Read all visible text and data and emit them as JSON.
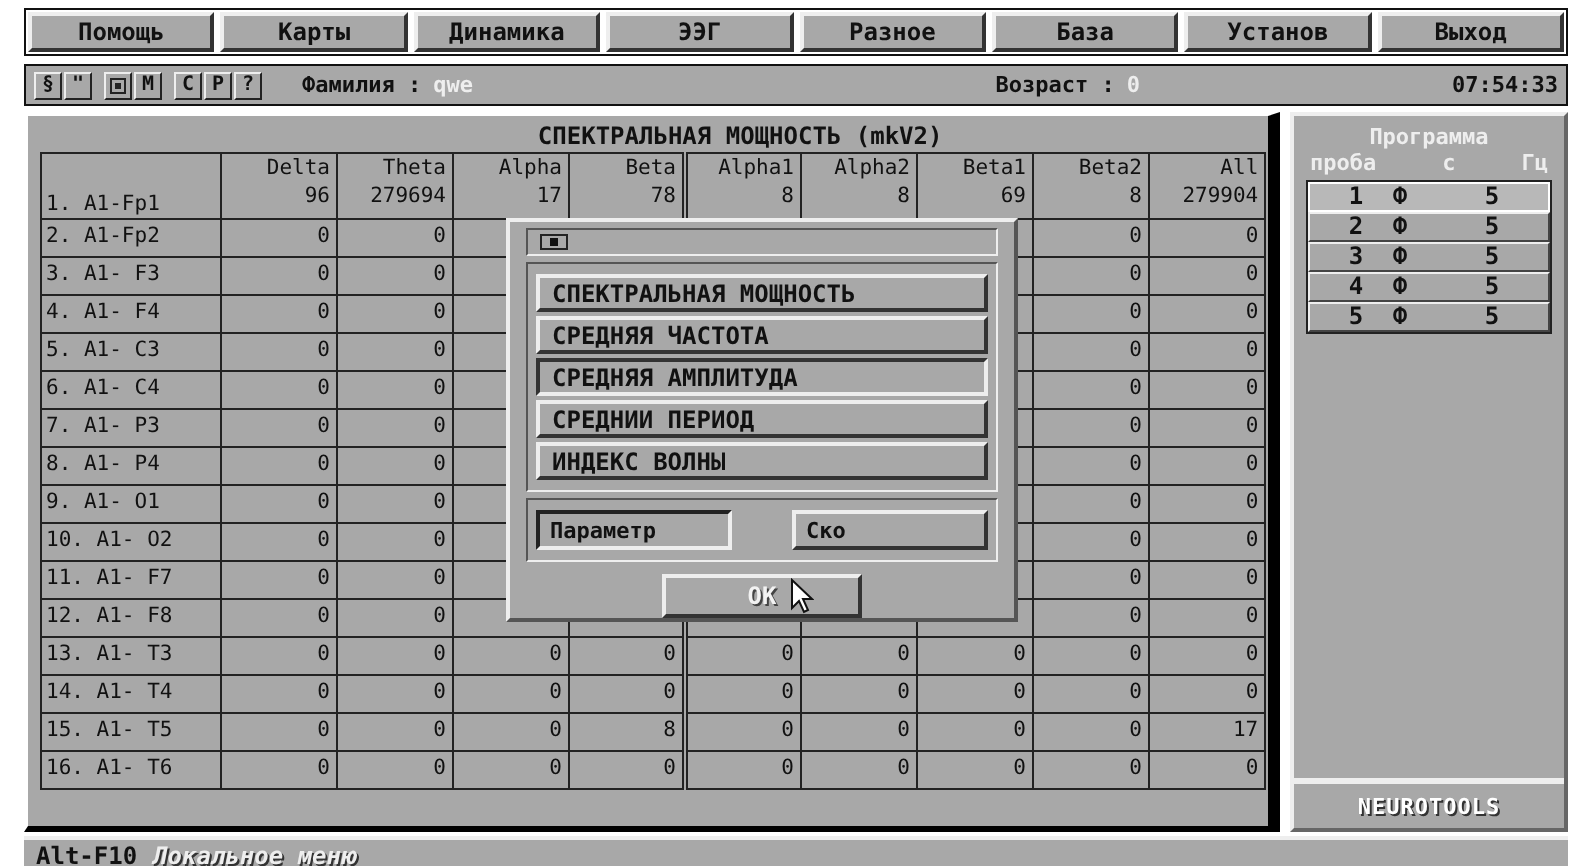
{
  "menu": [
    "Помощь",
    "Карты",
    "Динамика",
    "ЭЭГ",
    "Разное",
    "База",
    "Установ",
    "Выход"
  ],
  "toolbar": [
    {
      "kind": "text",
      "label": "§"
    },
    {
      "kind": "text",
      "label": "\""
    },
    {
      "kind": "icon"
    },
    {
      "kind": "text",
      "label": "M"
    },
    {
      "kind": "text",
      "label": "C"
    },
    {
      "kind": "text",
      "label": "P"
    },
    {
      "kind": "text",
      "label": "?"
    }
  ],
  "surname": {
    "label": "Фамилия :",
    "value": "qwe"
  },
  "age": {
    "label": "Возраст :",
    "value": "0"
  },
  "clock": "07:54:33",
  "table": {
    "title": "СПЕКТРАЛЬНАЯ МОЩНОСТЬ (mkV2)",
    "first_label": "1. A1-Fp1",
    "columns": [
      {
        "name": "Delta",
        "total": "96"
      },
      {
        "name": "Theta",
        "total": "279694"
      },
      {
        "name": "Alpha",
        "total": "17"
      },
      {
        "name": "Beta",
        "total": "78"
      },
      {
        "name": "Alpha1",
        "total": "8"
      },
      {
        "name": "Alpha2",
        "total": "8"
      },
      {
        "name": "Beta1",
        "total": "69"
      },
      {
        "name": "Beta2",
        "total": "8"
      },
      {
        "name": "All",
        "total": "279904"
      }
    ],
    "rows": [
      {
        "label": "2. A1-Fp2",
        "cells": [
          "0",
          "0",
          null,
          null,
          null,
          null,
          null,
          "0",
          "0"
        ]
      },
      {
        "label": "3. A1- F3",
        "cells": [
          "0",
          "0",
          null,
          null,
          null,
          null,
          null,
          "0",
          "0"
        ]
      },
      {
        "label": "4. A1- F4",
        "cells": [
          "0",
          "0",
          null,
          null,
          null,
          null,
          null,
          "0",
          "0"
        ]
      },
      {
        "label": "5. A1- C3",
        "cells": [
          "0",
          "0",
          null,
          null,
          null,
          null,
          null,
          "0",
          "0"
        ]
      },
      {
        "label": "6. A1- C4",
        "cells": [
          "0",
          "0",
          null,
          null,
          null,
          null,
          null,
          "0",
          "0"
        ]
      },
      {
        "label": "7. A1- P3",
        "cells": [
          "0",
          "0",
          null,
          null,
          null,
          null,
          null,
          "0",
          "0"
        ]
      },
      {
        "label": "8. A1- P4",
        "cells": [
          "0",
          "0",
          null,
          null,
          null,
          null,
          null,
          "0",
          "0"
        ]
      },
      {
        "label": "9. A1- O1",
        "cells": [
          "0",
          "0",
          null,
          null,
          null,
          null,
          null,
          "0",
          "0"
        ]
      },
      {
        "label": "10. A1- O2",
        "cells": [
          "0",
          "0",
          null,
          null,
          null,
          null,
          null,
          "0",
          "0"
        ]
      },
      {
        "label": "11. A1- F7",
        "cells": [
          "0",
          "0",
          null,
          null,
          null,
          null,
          null,
          "0",
          "0"
        ]
      },
      {
        "label": "12. A1- F8",
        "cells": [
          "0",
          "0",
          null,
          null,
          null,
          null,
          null,
          "0",
          "0"
        ]
      },
      {
        "label": "13. A1- T3",
        "cells": [
          "0",
          "0",
          "0",
          "0",
          "0",
          "0",
          "0",
          "0",
          "0"
        ]
      },
      {
        "label": "14. A1- T4",
        "cells": [
          "0",
          "0",
          "0",
          "0",
          "0",
          "0",
          "0",
          "0",
          "0"
        ]
      },
      {
        "label": "15. A1- T5",
        "cells": [
          "0",
          "0",
          "0",
          "8",
          "0",
          "0",
          "0",
          "0",
          "17"
        ]
      },
      {
        "label": "16. A1- T6",
        "cells": [
          "0",
          "0",
          "0",
          "0",
          "0",
          "0",
          "0",
          "0",
          "0"
        ]
      }
    ]
  },
  "dialog": {
    "options": [
      {
        "label": "СПЕКТРАЛЬНАЯ МОЩНОСТЬ",
        "selected": false
      },
      {
        "label": "СРЕДНЯЯ ЧАСТОТА",
        "selected": false
      },
      {
        "label": "СРЕДНЯЯ АМПЛИТУДА",
        "selected": true
      },
      {
        "label": "СРЕДНИИ ПЕРИОД",
        "selected": false
      },
      {
        "label": "ИНДЕКС ВОЛНЫ",
        "selected": false
      }
    ],
    "toggles": [
      {
        "label": "Параметр",
        "selected": true
      },
      {
        "label": "Ско",
        "selected": false
      }
    ],
    "ok": {
      "label": "OK",
      "disabled": true
    }
  },
  "program": {
    "title": "Программа",
    "columns": [
      "проба",
      "с",
      "Гц"
    ],
    "rows": [
      {
        "cells": [
          "1",
          "Ф",
          "5"
        ],
        "selected": true
      },
      {
        "cells": [
          "2",
          "Ф",
          "5"
        ],
        "selected": false
      },
      {
        "cells": [
          "3",
          "Ф",
          "5"
        ],
        "selected": false
      },
      {
        "cells": [
          "4",
          "Ф",
          "5"
        ],
        "selected": false
      },
      {
        "cells": [
          "5",
          "Ф",
          "5"
        ],
        "selected": false
      }
    ],
    "brand": "NEUROTOOLS"
  },
  "status": {
    "key": "Alt-F10",
    "text": "Локальное меню"
  }
}
